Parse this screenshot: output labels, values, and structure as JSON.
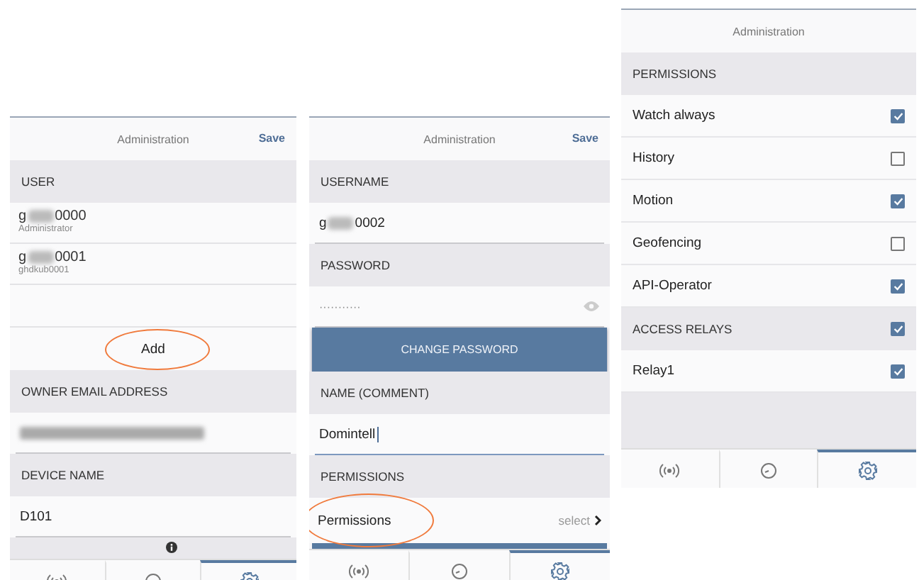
{
  "phones": [
    {
      "title": "Administration",
      "action": "Save",
      "items": [
        {
          "kind": "header",
          "label": "USER"
        },
        {
          "kind": "user",
          "prefix": "g",
          "suffix": "0000",
          "subtitle": "Administrator"
        },
        {
          "kind": "user",
          "prefix": "g",
          "suffix": "0001",
          "subtitle": "ghdkub0001"
        },
        {
          "kind": "blank"
        },
        {
          "kind": "add",
          "label": "Add",
          "highlighted": true
        },
        {
          "kind": "header",
          "label": "OWNER EMAIL ADDRESS"
        },
        {
          "kind": "blurred_field"
        },
        {
          "kind": "header",
          "label": "DEVICE NAME"
        },
        {
          "kind": "field",
          "value": "D101",
          "focused": false
        },
        {
          "kind": "info_header"
        }
      ],
      "tabs": [
        {
          "selected": false
        },
        {
          "selected": false
        },
        {
          "selected": true
        }
      ]
    },
    {
      "title": "Administration",
      "action": "Save",
      "items": [
        {
          "kind": "header",
          "label": "USERNAME"
        },
        {
          "kind": "masked_field",
          "prefix": "g",
          "suffix": "0002"
        },
        {
          "kind": "header",
          "label": "PASSWORD"
        },
        {
          "kind": "password",
          "value": "···········"
        },
        {
          "kind": "button",
          "label": "CHANGE PASSWORD"
        },
        {
          "kind": "header",
          "label": "NAME (COMMENT)"
        },
        {
          "kind": "field",
          "value": "Domintell",
          "focused": true
        },
        {
          "kind": "header",
          "label": "PERMISSIONS"
        },
        {
          "kind": "select",
          "label": "Permissions",
          "value": "select",
          "highlighted": true
        },
        {
          "kind": "cut_button"
        }
      ],
      "tabs": [
        {
          "selected": false
        },
        {
          "selected": false
        },
        {
          "selected": true
        }
      ]
    },
    {
      "title": "Administration",
      "items": [
        {
          "kind": "header",
          "label": "PERMISSIONS"
        },
        {
          "kind": "check",
          "label": "Watch always",
          "checked": true
        },
        {
          "kind": "check",
          "label": "History",
          "checked": false
        },
        {
          "kind": "check",
          "label": "Motion",
          "checked": true
        },
        {
          "kind": "check",
          "label": "Geofencing",
          "checked": false
        },
        {
          "kind": "check",
          "label": "API-Operator",
          "checked": true
        },
        {
          "kind": "check_header",
          "label": "ACCESS RELAYS",
          "checked": true
        },
        {
          "kind": "check",
          "label": "Relay1",
          "checked": true
        },
        {
          "kind": "filler"
        }
      ],
      "tabs": [
        {
          "selected": false
        },
        {
          "selected": false
        },
        {
          "selected": true
        }
      ]
    }
  ]
}
